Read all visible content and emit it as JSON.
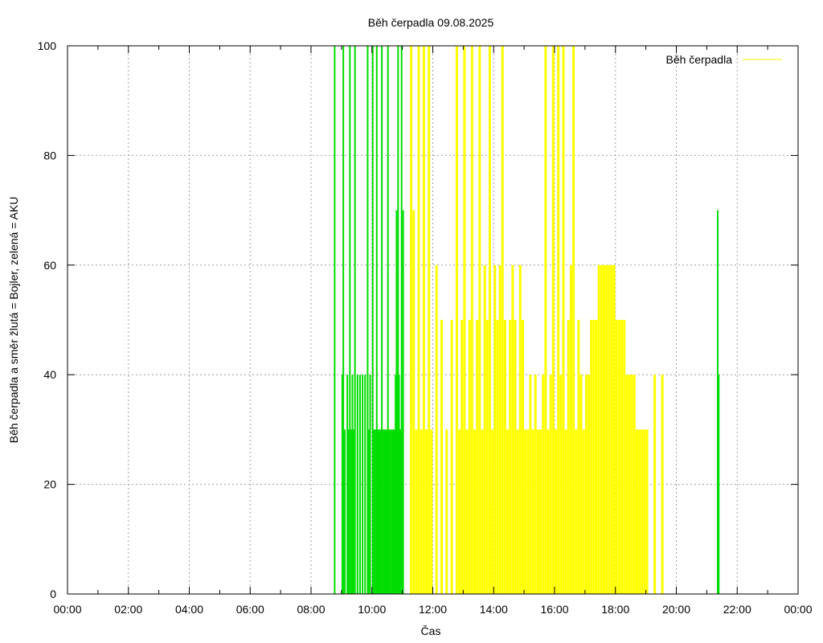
{
  "chart_data": {
    "type": "bar",
    "title": "Běh čerpadla 09.08.2025",
    "xlabel": "Čas",
    "ylabel": "Běh čerpadla a směr žlutá = Bojler, zelená = AKU",
    "x_range": [
      "00:00",
      "24:00"
    ],
    "ylim": [
      0,
      100
    ],
    "x_tick_labels": [
      "00:00",
      "02:00",
      "04:00",
      "06:00",
      "08:00",
      "10:00",
      "12:00",
      "14:00",
      "16:00",
      "18:00",
      "20:00",
      "22:00",
      "00:00"
    ],
    "y_tick_labels": [
      "0",
      "20",
      "40",
      "60",
      "80",
      "100"
    ],
    "y_ticks": [
      0,
      20,
      40,
      60,
      80,
      100
    ],
    "grid": true,
    "legend": {
      "position": "top-right",
      "entries": [
        {
          "label": "Běh čerpadla",
          "color": "#ffff00"
        }
      ]
    },
    "series": [
      {
        "color_name": "green",
        "meaning": "AKU",
        "color": "#00dd00",
        "points": [
          [
            "08:45",
            100
          ],
          [
            "09:00",
            40
          ],
          [
            "09:02",
            100
          ],
          [
            "09:05",
            30
          ],
          [
            "09:10",
            40
          ],
          [
            "09:12",
            30
          ],
          [
            "09:15",
            100
          ],
          [
            "09:17",
            30
          ],
          [
            "09:20",
            40
          ],
          [
            "09:22",
            30
          ],
          [
            "09:25",
            100
          ],
          [
            "09:30",
            40
          ],
          [
            "09:35",
            40
          ],
          [
            "09:40",
            40
          ],
          [
            "09:45",
            40
          ],
          [
            "09:50",
            100
          ],
          [
            "09:52",
            30
          ],
          [
            "09:55",
            40
          ],
          [
            "10:00",
            100
          ],
          [
            "10:02",
            30
          ],
          [
            "10:05",
            30
          ],
          [
            "10:08",
            100
          ],
          [
            "10:10",
            30
          ],
          [
            "10:13",
            30
          ],
          [
            "10:15",
            30
          ],
          [
            "10:18",
            100
          ],
          [
            "10:20",
            30
          ],
          [
            "10:23",
            30
          ],
          [
            "10:25",
            30
          ],
          [
            "10:28",
            30
          ],
          [
            "10:30",
            100
          ],
          [
            "10:32",
            30
          ],
          [
            "10:35",
            30
          ],
          [
            "10:38",
            30
          ],
          [
            "10:40",
            30
          ],
          [
            "10:43",
            30
          ],
          [
            "10:45",
            40
          ],
          [
            "10:47",
            70
          ],
          [
            "10:48",
            50
          ],
          [
            "10:50",
            100
          ],
          [
            "10:52",
            40
          ],
          [
            "10:55",
            30
          ],
          [
            "10:57",
            100
          ],
          [
            "11:00",
            70
          ],
          [
            "21:20",
            70
          ],
          [
            "21:22",
            40
          ]
        ]
      },
      {
        "color_name": "yellow",
        "meaning": "Bojler",
        "color": "#ffff00",
        "points": [
          [
            "11:15",
            100
          ],
          [
            "11:20",
            70
          ],
          [
            "11:25",
            30
          ],
          [
            "11:30",
            100
          ],
          [
            "11:35",
            30
          ],
          [
            "11:40",
            100
          ],
          [
            "11:45",
            30
          ],
          [
            "11:50",
            100
          ],
          [
            "11:55",
            30
          ],
          [
            "12:05",
            60
          ],
          [
            "12:15",
            50
          ],
          [
            "12:25",
            30
          ],
          [
            "12:35",
            50
          ],
          [
            "12:45",
            100
          ],
          [
            "12:50",
            30
          ],
          [
            "12:55",
            50
          ],
          [
            "13:00",
            100
          ],
          [
            "13:05",
            30
          ],
          [
            "13:10",
            50
          ],
          [
            "13:15",
            100
          ],
          [
            "13:20",
            30
          ],
          [
            "13:25",
            50
          ],
          [
            "13:30",
            100
          ],
          [
            "13:35",
            30
          ],
          [
            "13:40",
            60
          ],
          [
            "13:45",
            50
          ],
          [
            "13:50",
            100
          ],
          [
            "13:55",
            30
          ],
          [
            "14:00",
            60
          ],
          [
            "14:05",
            50
          ],
          [
            "14:10",
            60
          ],
          [
            "14:15",
            100
          ],
          [
            "14:20",
            50
          ],
          [
            "14:25",
            30
          ],
          [
            "14:30",
            50
          ],
          [
            "14:35",
            60
          ],
          [
            "14:40",
            50
          ],
          [
            "14:45",
            30
          ],
          [
            "14:50",
            60
          ],
          [
            "14:55",
            50
          ],
          [
            "15:00",
            30
          ],
          [
            "15:05",
            30
          ],
          [
            "15:10",
            40
          ],
          [
            "15:15",
            30
          ],
          [
            "15:20",
            40
          ],
          [
            "15:25",
            30
          ],
          [
            "15:30",
            30
          ],
          [
            "15:35",
            40
          ],
          [
            "15:40",
            100
          ],
          [
            "15:45",
            30
          ],
          [
            "15:50",
            40
          ],
          [
            "15:55",
            100
          ],
          [
            "16:00",
            30
          ],
          [
            "16:05",
            100
          ],
          [
            "16:10",
            40
          ],
          [
            "16:15",
            100
          ],
          [
            "16:20",
            30
          ],
          [
            "16:25",
            50
          ],
          [
            "16:30",
            60
          ],
          [
            "16:35",
            100
          ],
          [
            "16:40",
            30
          ],
          [
            "16:45",
            50
          ],
          [
            "16:50",
            40
          ],
          [
            "16:55",
            30
          ],
          [
            "17:00",
            40
          ],
          [
            "17:05",
            40
          ],
          [
            "17:10",
            50
          ],
          [
            "17:15",
            50
          ],
          [
            "17:20",
            50
          ],
          [
            "17:25",
            60
          ],
          [
            "17:30",
            60
          ],
          [
            "17:35",
            60
          ],
          [
            "17:40",
            60
          ],
          [
            "17:45",
            60
          ],
          [
            "17:50",
            60
          ],
          [
            "17:55",
            60
          ],
          [
            "18:00",
            50
          ],
          [
            "18:05",
            50
          ],
          [
            "18:10",
            50
          ],
          [
            "18:15",
            50
          ],
          [
            "18:20",
            40
          ],
          [
            "18:25",
            40
          ],
          [
            "18:30",
            40
          ],
          [
            "18:35",
            40
          ],
          [
            "18:40",
            30
          ],
          [
            "18:45",
            30
          ],
          [
            "18:50",
            30
          ],
          [
            "18:55",
            30
          ],
          [
            "19:00",
            30
          ],
          [
            "19:15",
            40
          ],
          [
            "19:30",
            40
          ]
        ]
      }
    ]
  }
}
